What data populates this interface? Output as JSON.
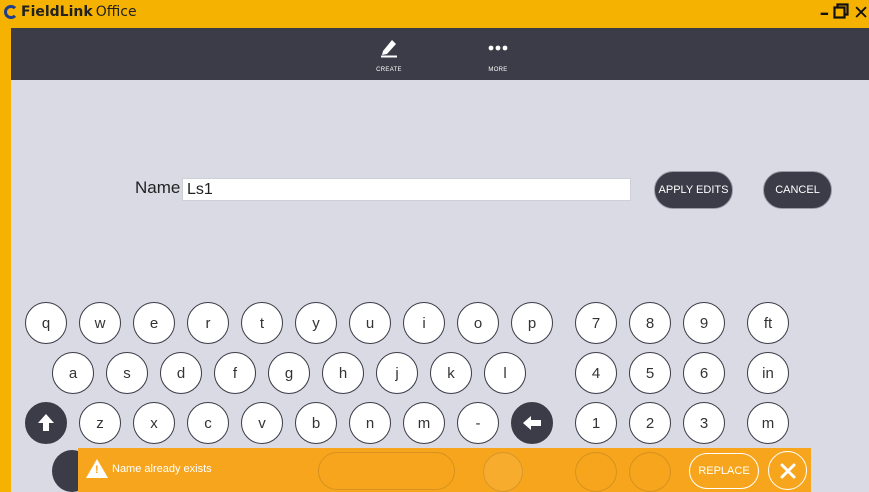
{
  "app": {
    "title_bold": "FieldLink",
    "title_rest": " Office"
  },
  "toolbar": {
    "create_label": "CREATE",
    "more_label": "MORE"
  },
  "form": {
    "name_label": "Name",
    "name_value": "Ls1",
    "apply_label": "APPLY EDITS",
    "cancel_label": "CANCEL"
  },
  "keyboard": {
    "row1": [
      "q",
      "w",
      "e",
      "r",
      "t",
      "y",
      "u",
      "i",
      "o",
      "p"
    ],
    "row2": [
      "a",
      "s",
      "d",
      "f",
      "g",
      "h",
      "j",
      "k",
      "l"
    ],
    "row3": [
      "z",
      "x",
      "c",
      "v",
      "b",
      "n",
      "m",
      "-"
    ],
    "num_row1": [
      "7",
      "8",
      "9"
    ],
    "num_row2": [
      "4",
      "5",
      "6"
    ],
    "num_row3": [
      "1",
      "2",
      "3"
    ],
    "unit_keys": [
      "ft",
      "in",
      "m"
    ]
  },
  "toast": {
    "message": "Name already exists",
    "replace_label": "REPLACE"
  },
  "colors": {
    "accent": "#f6b200",
    "dark": "#3b3c47",
    "background": "#d9dae4",
    "toast": "#f7a51c"
  },
  "icons": {
    "create": "pencil-icon",
    "more": "ellipsis-icon",
    "shift": "shift-up-icon",
    "backspace": "backspace-icon",
    "warning": "warning-icon",
    "close": "close-icon"
  }
}
